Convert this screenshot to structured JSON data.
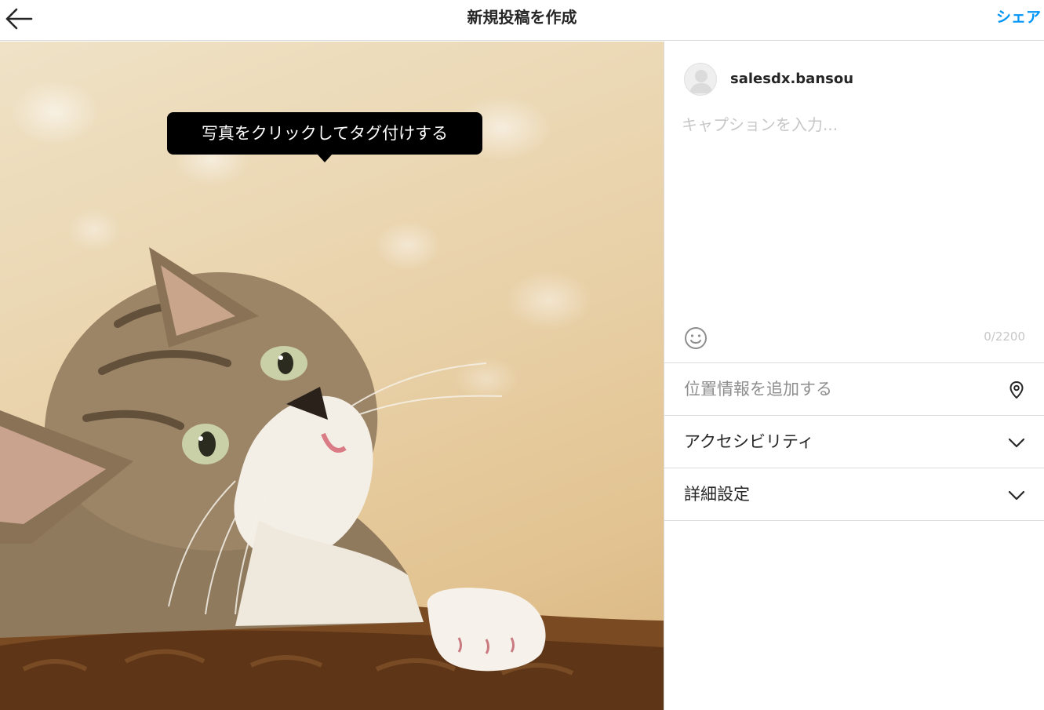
{
  "header": {
    "title": "新規投稿を作成",
    "share_label": "シェア",
    "back_icon": "arrow-left-icon"
  },
  "photo": {
    "tooltip": "写真をクリックしてタグ付けする"
  },
  "panel": {
    "username": "salesdx.bansou",
    "caption_placeholder": "キャプションを入力...",
    "caption_value": "",
    "char_count": "0/2200",
    "emoji_icon": "smiley-icon",
    "location_label": "位置情報を追加する",
    "location_icon": "location-pin-icon",
    "accessibility_label": "アクセシビリティ",
    "advanced_label": "詳細設定",
    "chevron_icon": "chevron-down-icon"
  },
  "colors": {
    "accent": "#0095f6",
    "border": "#dbdbdb",
    "placeholder": "#c7c7c7",
    "muted": "#8e8e8e"
  }
}
